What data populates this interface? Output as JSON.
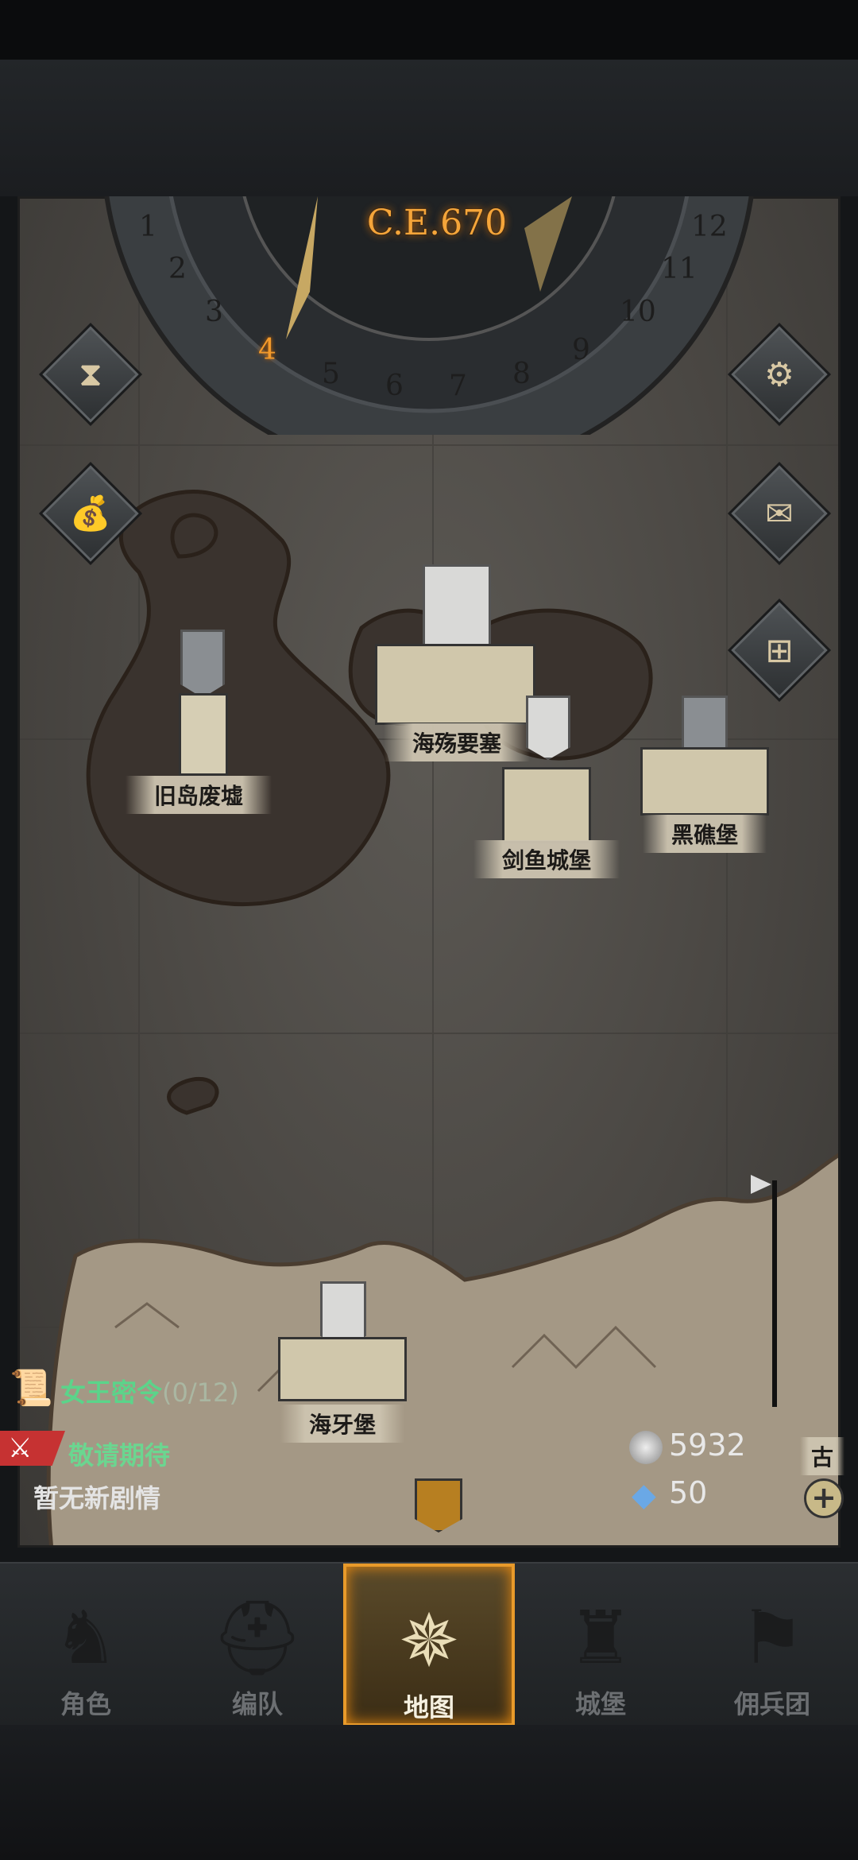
{
  "calendar": {
    "year_label": "C.E.670",
    "months": [
      "1",
      "2",
      "3",
      "4",
      "5",
      "6",
      "7",
      "8",
      "9",
      "10",
      "11",
      "12"
    ],
    "current_month": "4"
  },
  "locations": [
    {
      "name": "旧岛废墟"
    },
    {
      "name": "海殇要塞"
    },
    {
      "name": "剑鱼城堡"
    },
    {
      "name": "黑礁堡"
    },
    {
      "name": "海牙堡"
    },
    {
      "name": "古"
    }
  ],
  "quest": {
    "title": "女王密令",
    "progress": "(0/12)",
    "stub": "敬请期待",
    "story_status": "暂无新剧情"
  },
  "resources": {
    "silver": "5932",
    "crystal": "50"
  },
  "side_buttons": [
    "hourglass-icon",
    "bag-icon",
    "gear-icon",
    "mail-icon",
    "window-icon"
  ],
  "nav": {
    "items": [
      {
        "label": "角色"
      },
      {
        "label": "编队"
      },
      {
        "label": "地图"
      },
      {
        "label": "城堡"
      },
      {
        "label": "佣兵团"
      }
    ],
    "active": "地图"
  },
  "colors": {
    "accent": "#e89a2a",
    "quest_green": "#5bd48a"
  }
}
